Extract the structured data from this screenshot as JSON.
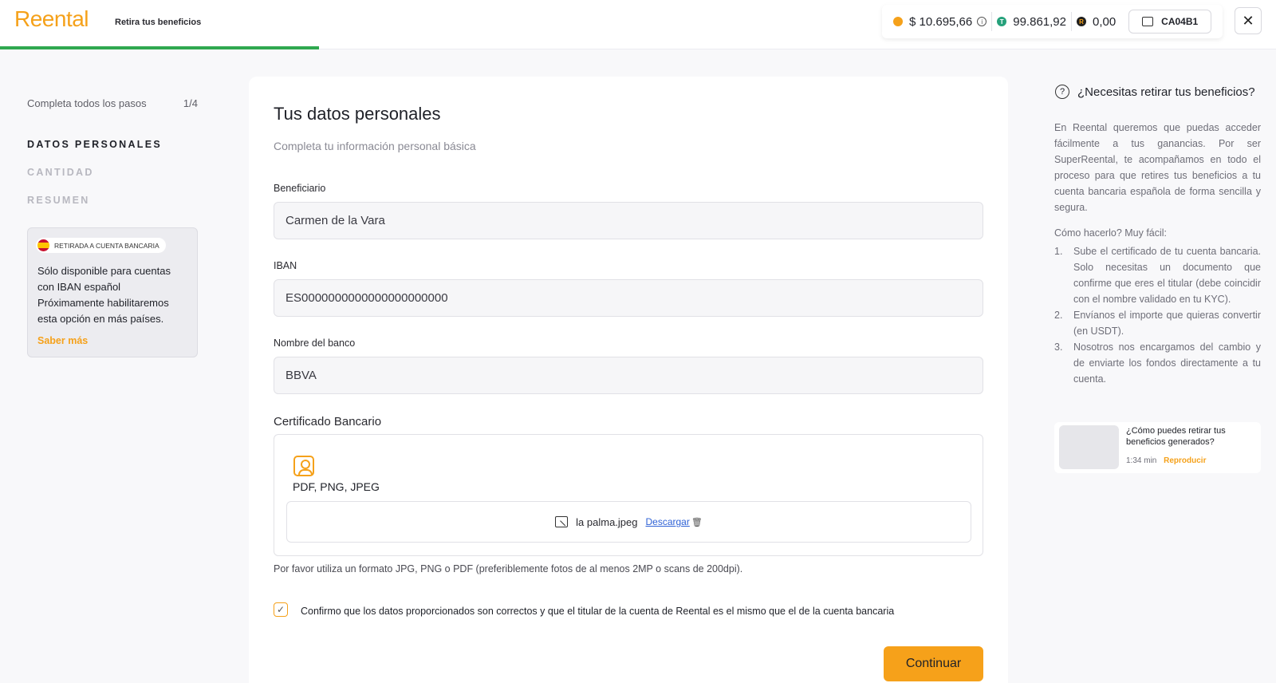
{
  "header": {
    "logo": "Reental",
    "subtitle": "Retira tus beneficios",
    "progress_percent": 25,
    "balances": [
      {
        "icon": "house-coin-icon",
        "value": "$ 10.695,66",
        "color": "#f5a11a"
      },
      {
        "icon": "tether-icon",
        "value": "99.861,92",
        "color": "#26a17b"
      },
      {
        "icon": "reental-token-icon",
        "value": "0,00",
        "color": "#1f1f1f"
      }
    ],
    "wallet": "CA04B1"
  },
  "sidebar": {
    "heading": "Completa todos los pasos",
    "counter": "1/4",
    "steps": [
      {
        "label": "DATOS PERSONALES",
        "active": true
      },
      {
        "label": "CANTIDAD",
        "active": false
      },
      {
        "label": "RESUMEN",
        "active": false
      }
    ],
    "card": {
      "badge": "RETIRADA A CUENTA BANCARIA",
      "text": "Sólo disponible para cuentas con IBAN español Próximamente habilitaremos esta opción en más países.",
      "link": "Saber más"
    }
  },
  "form": {
    "title": "Tus datos personales",
    "subtitle": "Completa tu información personal básica",
    "beneficiary": {
      "label": "Beneficiario",
      "value": "Carmen de la Vara"
    },
    "iban": {
      "label": "IBAN",
      "value": "ES0000000000000000000000"
    },
    "bank": {
      "label": "Nombre del banco",
      "value": "BBVA"
    },
    "certificate": {
      "label": "Certificado Bancario",
      "formats": "PDF, PNG, JPEG",
      "file_name": "la palma.jpeg",
      "download": "Descargar"
    },
    "hint": "Por favor utiliza un formato JPG, PNG o PDF (preferiblemente fotos de al menos 2MP o scans de 200dpi).",
    "confirm": "Confirmo que los datos proporcionados son correctos y que el titular de la cuenta de Reental es el mismo que el de la cuenta bancaria",
    "confirm_checked": true,
    "continue": "Continuar"
  },
  "help": {
    "title": "¿Necesitas retirar tus beneficios?",
    "intro": "En Reental queremos que puedas acceder fácilmente a tus ganancias. Por ser SuperReental, te acompañamos en todo el proceso para que retires tus beneficios a tu cuenta bancaria española de forma sencilla y segura.",
    "how": "Cómo hacerlo? Muy fácil:",
    "steps": [
      "Sube el certificado de tu cuenta bancaria. Solo necesitas un documento que confirme que eres el titular (debe coincidir con el nombre validado en tu KYC).",
      "Envíanos el importe que quieras convertir (en USDT).",
      "Nosotros nos encargamos del cambio y de enviarte los fondos directamente a tu cuenta."
    ],
    "video": {
      "title": "¿Cómo puedes retirar tus beneficios generados?",
      "duration": "1:34 min",
      "play": "Reproducir"
    }
  }
}
